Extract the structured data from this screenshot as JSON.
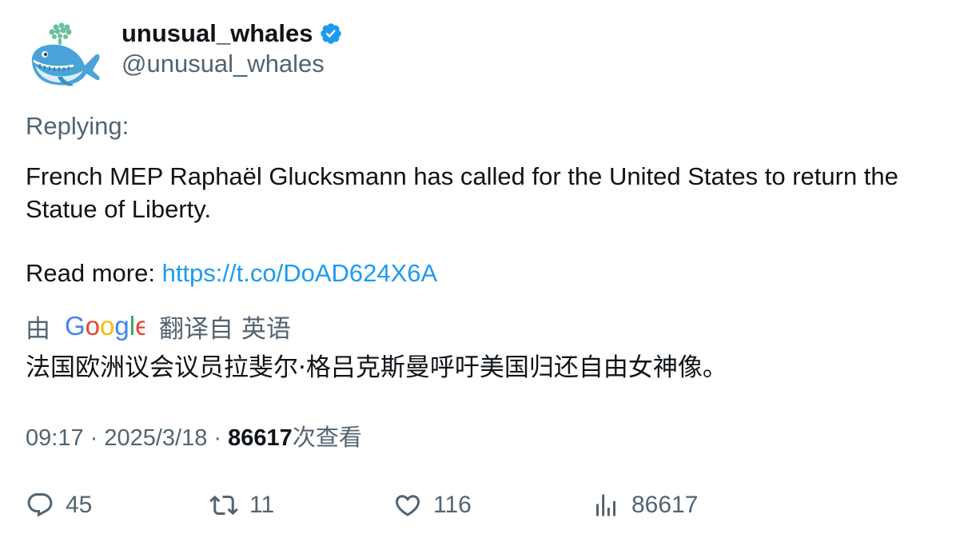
{
  "author": {
    "display_name": "unusual_whales",
    "handle": "@unusual_whales",
    "avatar_icon": "whale-logo-icon",
    "verified_icon": "verified-badge-icon",
    "verified_color": "#1d9bf0"
  },
  "tweet": {
    "replying_label": "Replying:",
    "text_line1": "French MEP Raphaël Glucksmann has called for the United States to return the Statue of Liberty.",
    "read_more_label": "Read more: ",
    "link_text": "https://t.co/DoAD624X6A"
  },
  "translation": {
    "by_label": "由",
    "provider_logo": "Google",
    "translated_from_label": "翻译自 英语",
    "translated_text": "法国欧洲议会议员拉斐尔·格吕克斯曼呼吁美国归还自由女神像。"
  },
  "meta": {
    "time": "09:17",
    "separator": " · ",
    "date": "2025/3/18",
    "views_count": "86617",
    "views_label": "次查看"
  },
  "actions": {
    "replies": "45",
    "retweets": "11",
    "likes": "116",
    "views": "86617"
  },
  "colors": {
    "text_primary": "#0f1419",
    "text_secondary": "#536471",
    "link": "#1d9bf0"
  }
}
